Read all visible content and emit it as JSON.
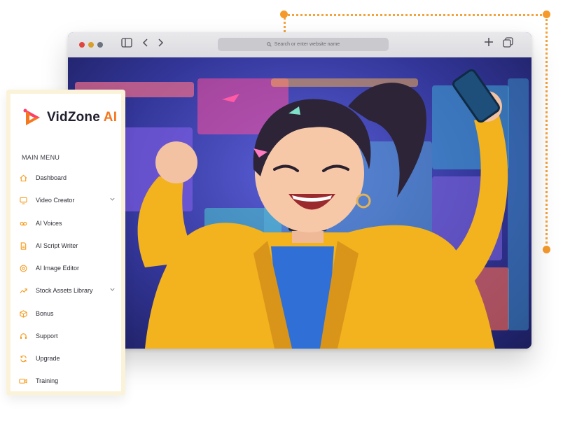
{
  "browser": {
    "url_placeholder": "Search or enter website name"
  },
  "app": {
    "brand_main": "VidZone",
    "brand_accent": "AI",
    "accent_color": "#f5771f"
  },
  "sidebar": {
    "heading": "MAIN MENU",
    "items": [
      {
        "label": "Dashboard",
        "icon": "home-icon"
      },
      {
        "label": "Video Creator",
        "icon": "monitor-icon",
        "expandable": true
      },
      {
        "label": "AI Voices",
        "icon": "voicemail-icon"
      },
      {
        "label": "AI Script Writer",
        "icon": "document-icon"
      },
      {
        "label": "AI Image Editor",
        "icon": "aperture-icon"
      },
      {
        "label": "Stock Assets Library",
        "icon": "trending-icon",
        "expandable": true
      },
      {
        "label": "Bonus",
        "icon": "box-icon"
      },
      {
        "label": "Support",
        "icon": "headset-icon"
      },
      {
        "label": "Upgrade",
        "icon": "refresh-icon"
      },
      {
        "label": "Training",
        "icon": "video-icon"
      }
    ]
  }
}
